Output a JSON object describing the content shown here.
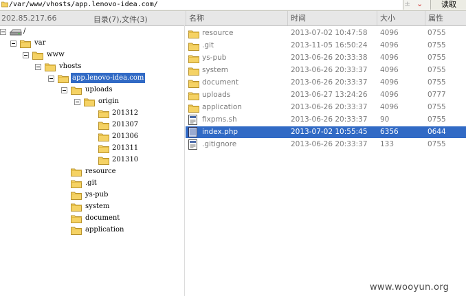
{
  "address": {
    "path": "/var/www/vhosts/app.lenovo-idea.com/",
    "up_glyph": "±",
    "down_glyph": "⌄",
    "button_label": "读取"
  },
  "header": {
    "ip": "202.85.217.66",
    "summary": "目录(7),文件(3)",
    "columns": [
      "名称",
      "时间",
      "大小",
      "属性"
    ]
  },
  "tree": [
    {
      "label": "/",
      "icon": "drive-icon",
      "level": 0,
      "expander": true
    },
    {
      "label": "var",
      "icon": "folder-icon",
      "level": 1,
      "expander": true
    },
    {
      "label": "www",
      "icon": "folder-icon",
      "level": 2,
      "expander": true
    },
    {
      "label": "vhosts",
      "icon": "folder-icon",
      "level": 3,
      "expander": true
    },
    {
      "label": "app.lenovo-idea.com",
      "icon": "folder-icon",
      "level": 4,
      "expander": true,
      "selected": true
    },
    {
      "label": "uploads",
      "icon": "folder-icon",
      "level": 5,
      "expander": true
    },
    {
      "label": "origin",
      "icon": "folder-icon",
      "level": 6,
      "expander": true
    },
    {
      "label": "201312",
      "icon": "folder-icon",
      "level": 7
    },
    {
      "label": "201307",
      "icon": "folder-icon",
      "level": 7
    },
    {
      "label": "201306",
      "icon": "folder-icon",
      "level": 7
    },
    {
      "label": "201311",
      "icon": "folder-icon",
      "level": 7
    },
    {
      "label": "201310",
      "icon": "folder-icon",
      "level": 7
    },
    {
      "label": "resource",
      "icon": "folder-icon",
      "level": 5
    },
    {
      "label": ".git",
      "icon": "folder-icon",
      "level": 5
    },
    {
      "label": "ys-pub",
      "icon": "folder-icon",
      "level": 5
    },
    {
      "label": "system",
      "icon": "folder-icon",
      "level": 5
    },
    {
      "label": "document",
      "icon": "folder-icon",
      "level": 5
    },
    {
      "label": "application",
      "icon": "folder-icon",
      "level": 5
    }
  ],
  "files": [
    {
      "name": "resource",
      "time": "2013-07-02 10:47:58",
      "size": "4096",
      "perm": "0755",
      "icon": "folder-icon"
    },
    {
      "name": ".git",
      "time": "2013-11-05 16:50:24",
      "size": "4096",
      "perm": "0755",
      "icon": "folder-icon"
    },
    {
      "name": "ys-pub",
      "time": "2013-06-26 20:33:38",
      "size": "4096",
      "perm": "0755",
      "icon": "folder-icon"
    },
    {
      "name": "system",
      "time": "2013-06-26 20:33:37",
      "size": "4096",
      "perm": "0755",
      "icon": "folder-icon"
    },
    {
      "name": "document",
      "time": "2013-06-26 20:33:37",
      "size": "4096",
      "perm": "0755",
      "icon": "folder-icon"
    },
    {
      "name": "uploads",
      "time": "2013-06-27 13:24:26",
      "size": "4096",
      "perm": "0777",
      "icon": "folder-icon"
    },
    {
      "name": "application",
      "time": "2013-06-26 20:33:37",
      "size": "4096",
      "perm": "0755",
      "icon": "folder-icon"
    },
    {
      "name": "fixpms.sh",
      "time": "2013-06-26 20:33:37",
      "size": "90",
      "perm": "0755",
      "icon": "file-icon"
    },
    {
      "name": "index.php",
      "time": "2013-07-02 10:55:45",
      "size": "6356",
      "perm": "0644",
      "icon": "php-file-icon",
      "selected": true
    },
    {
      "name": ".gitignore",
      "time": "2013-06-26 20:33:37",
      "size": "133",
      "perm": "0755",
      "icon": "file-icon"
    }
  ],
  "watermark": "www.wooyun.org",
  "colors": {
    "selection": "#316ac5",
    "folder": "#f5d264"
  }
}
